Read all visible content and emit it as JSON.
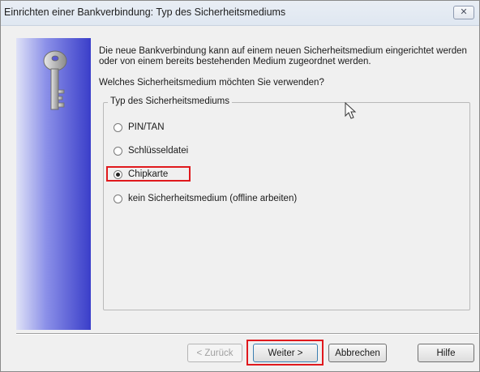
{
  "window": {
    "title": "Einrichten einer Bankverbindung: Typ des Sicherheitsmediums",
    "close_symbol": "✕"
  },
  "intro_text": "Die neue Bankverbindung kann  auf einem neuen Sicherheitsmedium eingerichtet werden oder von einem bereits bestehenden Medium zugeordnet werden.",
  "question": "Welches Sicherheitsmedium möchten Sie verwenden?",
  "group": {
    "label": "Typ des Sicherheitsmediums",
    "options": [
      {
        "label": "PIN/TAN",
        "checked": false
      },
      {
        "label": "Schlüsseldatei",
        "checked": false
      },
      {
        "label": "Chipkarte",
        "checked": true
      },
      {
        "label": "kein Sicherheitsmedium (offline arbeiten)",
        "checked": false
      }
    ]
  },
  "buttons": {
    "back": "< Zurück",
    "next": "Weiter >",
    "cancel": "Abbrechen",
    "help": "Hilfe"
  },
  "icons": {
    "side": "key-icon",
    "close": "close-icon",
    "cursor": "mouse-pointer-icon"
  },
  "colors": {
    "highlight": "#e0191d",
    "panel_gradient_end": "#3a3ec9"
  }
}
